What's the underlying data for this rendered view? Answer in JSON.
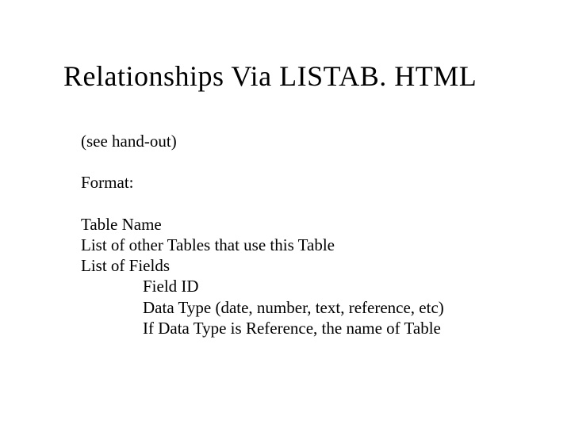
{
  "title": "Relationships Via LISTAB. HTML",
  "note": "(see hand-out)",
  "format_label": "Format:",
  "lines": {
    "l1": "Table Name",
    "l2": "List of other Tables that use this Table",
    "l3": "List of Fields",
    "l4": "Field ID",
    "l5": "Data Type (date, number, text, reference, etc)",
    "l6": "If Data Type is Reference, the name of Table"
  }
}
